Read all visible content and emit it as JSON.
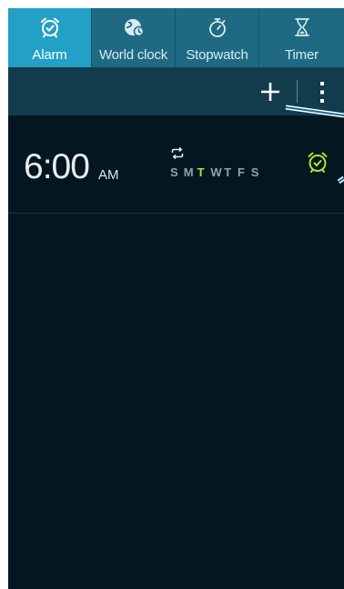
{
  "tabs": [
    {
      "label": "Alarm",
      "icon": "alarm-clock-icon",
      "active": true
    },
    {
      "label": "World clock",
      "icon": "globe-icon",
      "active": false
    },
    {
      "label": "Stopwatch",
      "icon": "stopwatch-icon",
      "active": false
    },
    {
      "label": "Timer",
      "icon": "hourglass-icon",
      "active": false
    }
  ],
  "action_bar": {
    "add_icon": "plus-icon",
    "more_icon": "more-options-icon"
  },
  "alarms": [
    {
      "time": "6:00",
      "ampm": "AM",
      "repeat_icon": "repeat-icon",
      "days": [
        "S",
        "M",
        "T",
        "W",
        "T",
        "F",
        "S"
      ],
      "active_day_index": 2,
      "toggle_icon": "alarm-on-icon"
    }
  ],
  "colors": {
    "background": "#041720",
    "tab_bar": "#1f6a82",
    "tab_active": "#22a0c6",
    "action_bar": "#123c4c",
    "accent_green": "#b6df3a",
    "callout_line": "#0c6f96"
  }
}
